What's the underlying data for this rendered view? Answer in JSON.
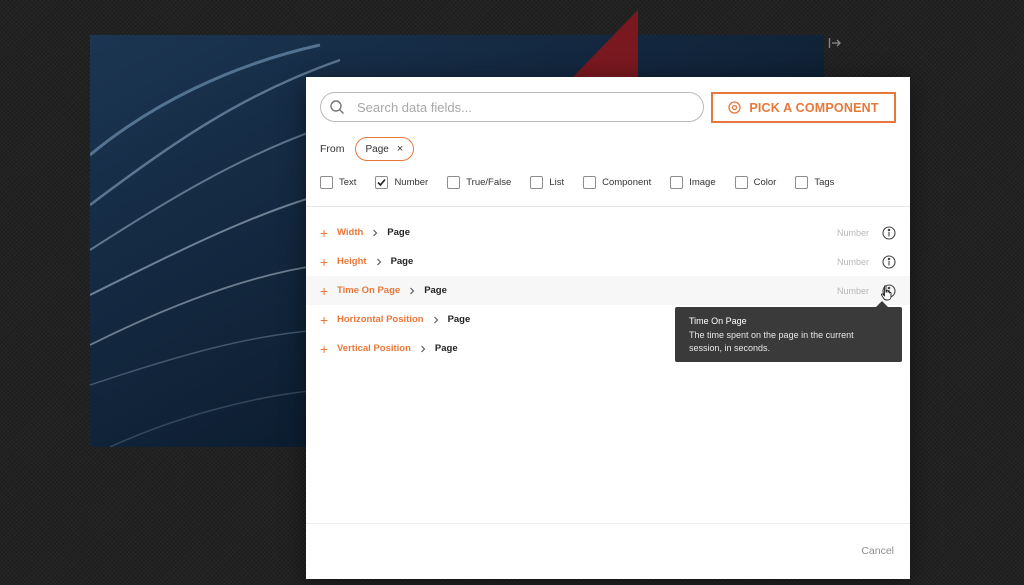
{
  "search": {
    "placeholder": "Search data fields..."
  },
  "pick_component": {
    "label": "PICK A COMPONENT"
  },
  "from": {
    "label": "From",
    "chip": "Page",
    "chip_close": "×"
  },
  "filters": [
    {
      "label": "Text",
      "checked": false
    },
    {
      "label": "Number",
      "checked": true
    },
    {
      "label": "True/False",
      "checked": false
    },
    {
      "label": "List",
      "checked": false
    },
    {
      "label": "Component",
      "checked": false
    },
    {
      "label": "Image",
      "checked": false
    },
    {
      "label": "Color",
      "checked": false
    },
    {
      "label": "Tags",
      "checked": false
    }
  ],
  "fields": [
    {
      "name": "Width",
      "path": "Page",
      "type": "Number"
    },
    {
      "name": "Height",
      "path": "Page",
      "type": "Number"
    },
    {
      "name": "Time On Page",
      "path": "Page",
      "type": "Number"
    },
    {
      "name": "Horizontal Position",
      "path": "Page",
      "type": ""
    },
    {
      "name": "Vertical Position",
      "path": "Page",
      "type": ""
    }
  ],
  "tooltip": {
    "title": "Time On Page",
    "body": "The time spent on the page in the current session, in seconds."
  },
  "footer": {
    "cancel": "Cancel"
  },
  "colors": {
    "accent": "#e8783a",
    "tooltip_bg": "#3a3a3a"
  },
  "icons": {
    "search": "search-icon",
    "pick": "target-icon",
    "info": "info-icon",
    "separator": "chevron-right-icon",
    "add": "plus-icon",
    "exit": "exit-icon"
  }
}
